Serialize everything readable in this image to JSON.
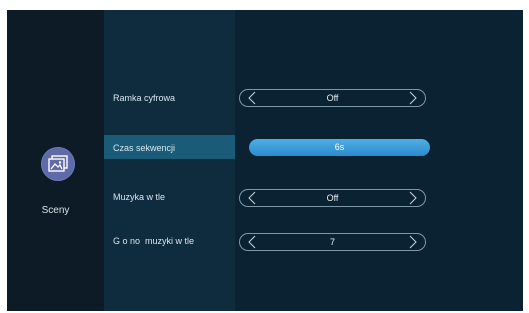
{
  "sidebar": {
    "app": {
      "icon": "picture-frame-icon",
      "label": "Sceny"
    }
  },
  "settings": {
    "rows": [
      {
        "label": "Ramka cyfrowa",
        "value": "Off",
        "selected": false
      },
      {
        "label": "Czas sekwencji",
        "value": "6s",
        "selected": true
      },
      {
        "label": "Muzyka w tle",
        "value": "Off",
        "selected": false
      },
      {
        "label": "G o no  muzyki w tle",
        "value": "7",
        "selected": false
      }
    ]
  },
  "colors": {
    "background": "#0b2132",
    "highlight": "#1a5b78",
    "active_selector": "#3a9ddb",
    "icon": "#5f6aa8"
  }
}
